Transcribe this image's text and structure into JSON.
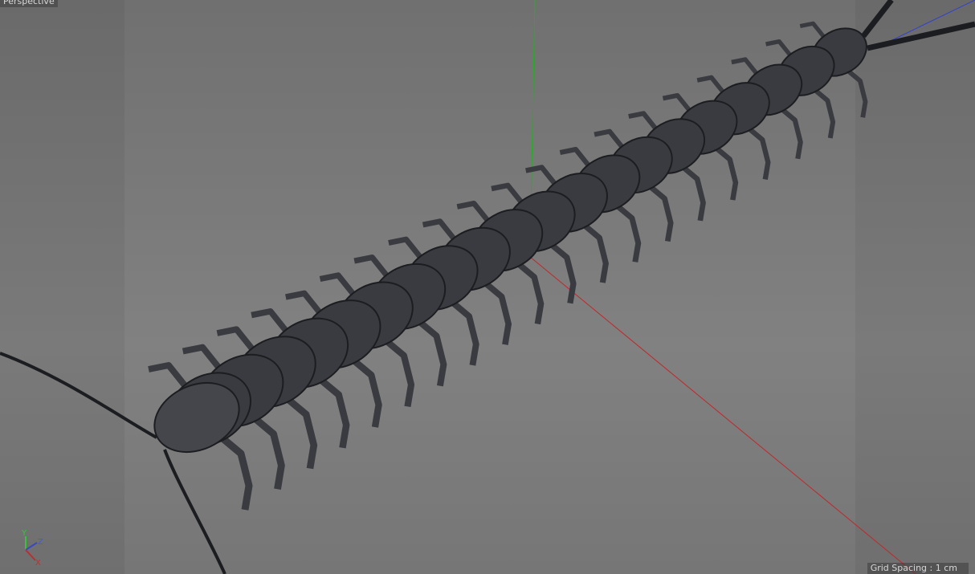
{
  "viewport": {
    "camera_label": "Perspective",
    "grid_spacing": "Grid Spacing : 1 cm"
  },
  "axis_gizmo": {
    "y": "Y",
    "z": "Z",
    "x": "X"
  },
  "colors": {
    "x_axis": "#c0282a",
    "y_axis": "#22b022",
    "z_axis": "#3040d0",
    "mesh": "#3a3b40",
    "wire": "#1c1d20"
  }
}
